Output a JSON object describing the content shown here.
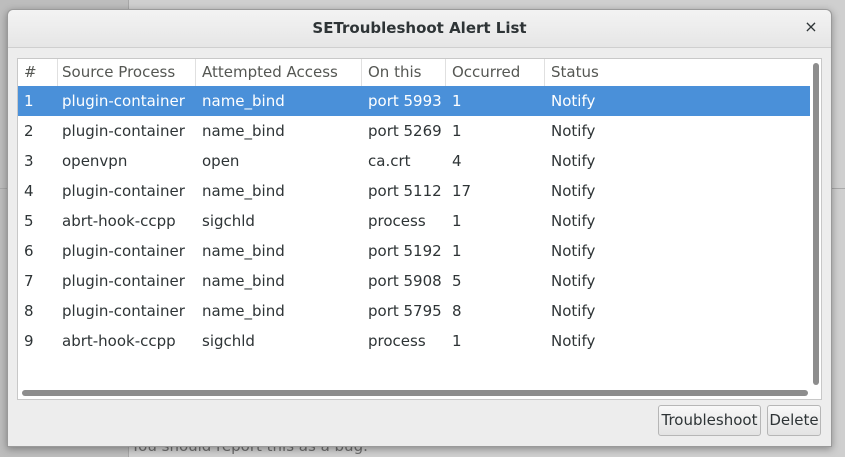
{
  "background": {
    "bottom_text": "You should report this as a bug."
  },
  "dialog": {
    "title": "SETroubleshoot Alert List",
    "close_glyph": "×"
  },
  "table": {
    "columns": [
      "#",
      "Source Process",
      "Attempted Access",
      "On this",
      "Occurred",
      "Status"
    ],
    "rows": [
      {
        "num": "1",
        "process": "plugin-container",
        "access": "name_bind",
        "target": "port 5993",
        "occurred": "1",
        "status": "Notify"
      },
      {
        "num": "2",
        "process": "plugin-container",
        "access": "name_bind",
        "target": "port 5269",
        "occurred": "1",
        "status": "Notify"
      },
      {
        "num": "3",
        "process": "openvpn",
        "access": "open",
        "target": "ca.crt",
        "occurred": "4",
        "status": "Notify"
      },
      {
        "num": "4",
        "process": "plugin-container",
        "access": "name_bind",
        "target": "port 5112",
        "occurred": "17",
        "status": "Notify"
      },
      {
        "num": "5",
        "process": "abrt-hook-ccpp",
        "access": "sigchld",
        "target": "process",
        "occurred": "1",
        "status": "Notify"
      },
      {
        "num": "6",
        "process": "plugin-container",
        "access": "name_bind",
        "target": "port 5192",
        "occurred": "1",
        "status": "Notify"
      },
      {
        "num": "7",
        "process": "plugin-container",
        "access": "name_bind",
        "target": "port 5908",
        "occurred": "5",
        "status": "Notify"
      },
      {
        "num": "8",
        "process": "plugin-container",
        "access": "name_bind",
        "target": "port 5795",
        "occurred": "8",
        "status": "Notify"
      },
      {
        "num": "9",
        "process": "abrt-hook-ccpp",
        "access": "sigchld",
        "target": "process",
        "occurred": "1",
        "status": "Notify"
      }
    ],
    "selected_index": 0
  },
  "buttons": {
    "troubleshoot": "Troubleshoot",
    "delete": "Delete"
  },
  "colors": {
    "selection": "#4a90d9"
  }
}
